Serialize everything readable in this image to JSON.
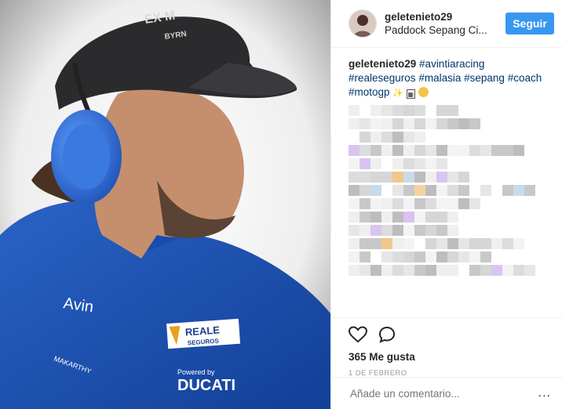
{
  "header": {
    "username": "geletenieto29",
    "location": "Paddock Sepang Ci...",
    "follow_label": "Seguir"
  },
  "caption": {
    "username": "geletenieto29",
    "hashtags": [
      "#avintiaracing",
      "#realeseguros",
      "#malasia",
      "#sepang",
      "#coach",
      "#motogp"
    ],
    "star": "✨",
    "emoji_box": "▦"
  },
  "photo": {
    "cap_text_top": "EX M",
    "cap_text_mid": "BYRN",
    "shirt_brand": "Avin",
    "sponsor_main": "REALE",
    "sponsor_sub": "SEGUROS",
    "makarthy": "MAKARTHY",
    "powered_by": "Powered by",
    "ducati": "DUCATI"
  },
  "actions": {
    "likes": "365 Me gusta",
    "date": "1 DE FEBRERO"
  },
  "comment": {
    "placeholder": "Añade un comentario...",
    "more": "..."
  },
  "icons": {
    "like": "heart-icon",
    "comment": "speech-bubble-icon",
    "options": "more-options-icon"
  }
}
